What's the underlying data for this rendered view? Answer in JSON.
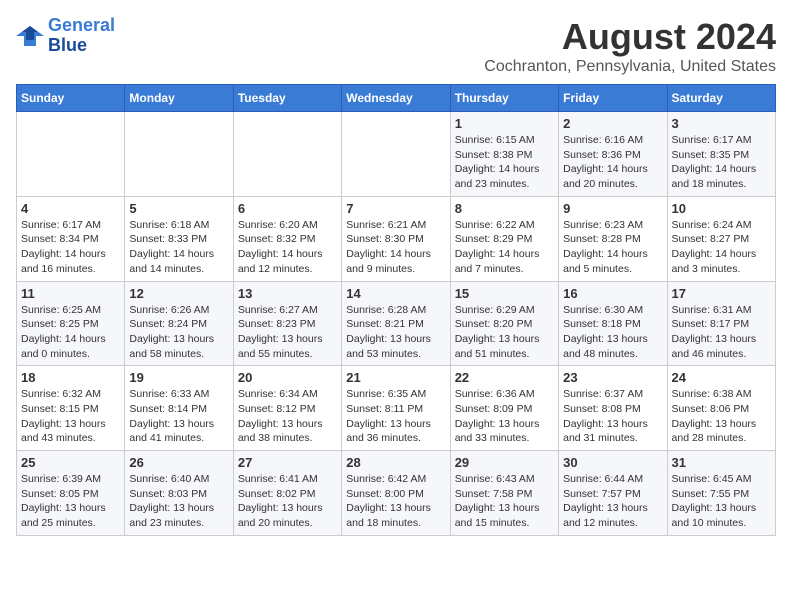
{
  "header": {
    "logo_line1": "General",
    "logo_line2": "Blue",
    "month_title": "August 2024",
    "location": "Cochranton, Pennsylvania, United States"
  },
  "weekdays": [
    "Sunday",
    "Monday",
    "Tuesday",
    "Wednesday",
    "Thursday",
    "Friday",
    "Saturday"
  ],
  "weeks": [
    [
      {
        "day": "",
        "info": ""
      },
      {
        "day": "",
        "info": ""
      },
      {
        "day": "",
        "info": ""
      },
      {
        "day": "",
        "info": ""
      },
      {
        "day": "1",
        "info": "Sunrise: 6:15 AM\nSunset: 8:38 PM\nDaylight: 14 hours\nand 23 minutes."
      },
      {
        "day": "2",
        "info": "Sunrise: 6:16 AM\nSunset: 8:36 PM\nDaylight: 14 hours\nand 20 minutes."
      },
      {
        "day": "3",
        "info": "Sunrise: 6:17 AM\nSunset: 8:35 PM\nDaylight: 14 hours\nand 18 minutes."
      }
    ],
    [
      {
        "day": "4",
        "info": "Sunrise: 6:17 AM\nSunset: 8:34 PM\nDaylight: 14 hours\nand 16 minutes."
      },
      {
        "day": "5",
        "info": "Sunrise: 6:18 AM\nSunset: 8:33 PM\nDaylight: 14 hours\nand 14 minutes."
      },
      {
        "day": "6",
        "info": "Sunrise: 6:20 AM\nSunset: 8:32 PM\nDaylight: 14 hours\nand 12 minutes."
      },
      {
        "day": "7",
        "info": "Sunrise: 6:21 AM\nSunset: 8:30 PM\nDaylight: 14 hours\nand 9 minutes."
      },
      {
        "day": "8",
        "info": "Sunrise: 6:22 AM\nSunset: 8:29 PM\nDaylight: 14 hours\nand 7 minutes."
      },
      {
        "day": "9",
        "info": "Sunrise: 6:23 AM\nSunset: 8:28 PM\nDaylight: 14 hours\nand 5 minutes."
      },
      {
        "day": "10",
        "info": "Sunrise: 6:24 AM\nSunset: 8:27 PM\nDaylight: 14 hours\nand 3 minutes."
      }
    ],
    [
      {
        "day": "11",
        "info": "Sunrise: 6:25 AM\nSunset: 8:25 PM\nDaylight: 14 hours\nand 0 minutes."
      },
      {
        "day": "12",
        "info": "Sunrise: 6:26 AM\nSunset: 8:24 PM\nDaylight: 13 hours\nand 58 minutes."
      },
      {
        "day": "13",
        "info": "Sunrise: 6:27 AM\nSunset: 8:23 PM\nDaylight: 13 hours\nand 55 minutes."
      },
      {
        "day": "14",
        "info": "Sunrise: 6:28 AM\nSunset: 8:21 PM\nDaylight: 13 hours\nand 53 minutes."
      },
      {
        "day": "15",
        "info": "Sunrise: 6:29 AM\nSunset: 8:20 PM\nDaylight: 13 hours\nand 51 minutes."
      },
      {
        "day": "16",
        "info": "Sunrise: 6:30 AM\nSunset: 8:18 PM\nDaylight: 13 hours\nand 48 minutes."
      },
      {
        "day": "17",
        "info": "Sunrise: 6:31 AM\nSunset: 8:17 PM\nDaylight: 13 hours\nand 46 minutes."
      }
    ],
    [
      {
        "day": "18",
        "info": "Sunrise: 6:32 AM\nSunset: 8:15 PM\nDaylight: 13 hours\nand 43 minutes."
      },
      {
        "day": "19",
        "info": "Sunrise: 6:33 AM\nSunset: 8:14 PM\nDaylight: 13 hours\nand 41 minutes."
      },
      {
        "day": "20",
        "info": "Sunrise: 6:34 AM\nSunset: 8:12 PM\nDaylight: 13 hours\nand 38 minutes."
      },
      {
        "day": "21",
        "info": "Sunrise: 6:35 AM\nSunset: 8:11 PM\nDaylight: 13 hours\nand 36 minutes."
      },
      {
        "day": "22",
        "info": "Sunrise: 6:36 AM\nSunset: 8:09 PM\nDaylight: 13 hours\nand 33 minutes."
      },
      {
        "day": "23",
        "info": "Sunrise: 6:37 AM\nSunset: 8:08 PM\nDaylight: 13 hours\nand 31 minutes."
      },
      {
        "day": "24",
        "info": "Sunrise: 6:38 AM\nSunset: 8:06 PM\nDaylight: 13 hours\nand 28 minutes."
      }
    ],
    [
      {
        "day": "25",
        "info": "Sunrise: 6:39 AM\nSunset: 8:05 PM\nDaylight: 13 hours\nand 25 minutes."
      },
      {
        "day": "26",
        "info": "Sunrise: 6:40 AM\nSunset: 8:03 PM\nDaylight: 13 hours\nand 23 minutes."
      },
      {
        "day": "27",
        "info": "Sunrise: 6:41 AM\nSunset: 8:02 PM\nDaylight: 13 hours\nand 20 minutes."
      },
      {
        "day": "28",
        "info": "Sunrise: 6:42 AM\nSunset: 8:00 PM\nDaylight: 13 hours\nand 18 minutes."
      },
      {
        "day": "29",
        "info": "Sunrise: 6:43 AM\nSunset: 7:58 PM\nDaylight: 13 hours\nand 15 minutes."
      },
      {
        "day": "30",
        "info": "Sunrise: 6:44 AM\nSunset: 7:57 PM\nDaylight: 13 hours\nand 12 minutes."
      },
      {
        "day": "31",
        "info": "Sunrise: 6:45 AM\nSunset: 7:55 PM\nDaylight: 13 hours\nand 10 minutes."
      }
    ]
  ]
}
